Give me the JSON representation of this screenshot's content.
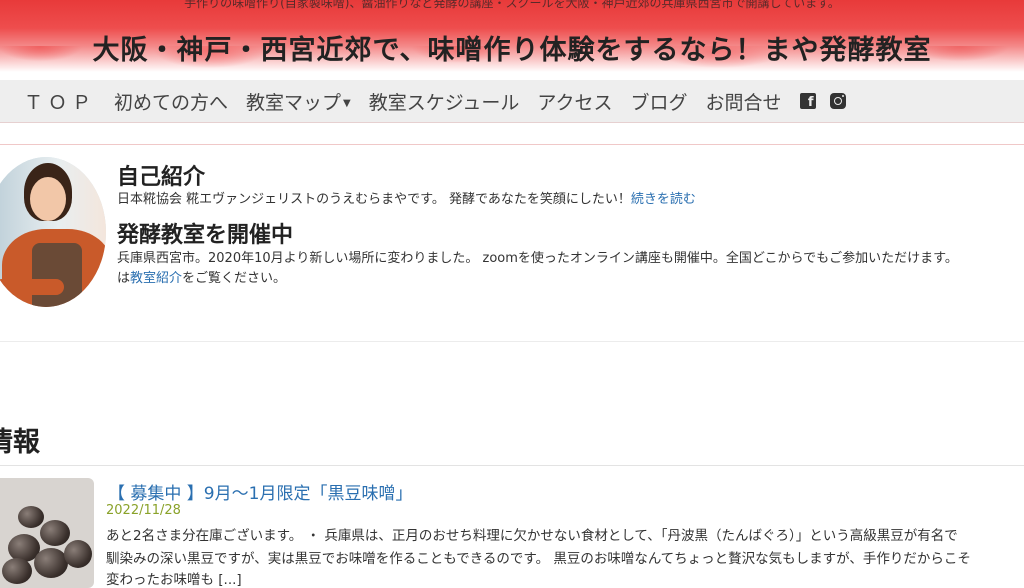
{
  "header": {
    "tagline": "手作りの味噌作り(自家製味噌)、醤油作りなど発酵の講座・スクールを大阪・神戸近郊の兵庫県西宮市で開講しています。",
    "site_title": "大阪・神戸・西宮近郊で、味噌作り体験をするなら！まや発酵教室"
  },
  "nav": {
    "items": [
      "ＴＯＰ",
      "初めての方へ",
      "教室マップ",
      "教室スケジュール",
      "アクセス",
      "ブログ",
      "お問合せ"
    ],
    "icons": [
      "facebook-icon",
      "instagram-icon"
    ]
  },
  "profile": {
    "heading1": "自己紹介",
    "intro_text": "日本糀協会 糀エヴァンジェリストのうえむらまやです。 発酵であなたを笑顔にしたい！",
    "read_more": "続きを読む",
    "heading2": "発酵教室を開催中",
    "class_text_line1": "兵庫県西宮市。2020年10月より新しい場所に変わりました。 zoomを使ったオンライン講座も開催中。全国どこからでもご参加いただけます。",
    "class_text_prefix": "は",
    "class_link": "教室紹介",
    "class_text_suffix": "をご覧ください。"
  },
  "news": {
    "section_title": "情報",
    "item": {
      "title": "【 募集中 】9月～1月限定「黒豆味噌」",
      "date": "2022/11/28",
      "excerpt_line1": "あと2名さま分在庫ございます。 ・ 兵庫県は、正月のおせち料理に欠かせない食材として、「丹波黒（たんばぐろ）」という高級黒豆が有名で",
      "excerpt_line2": "馴染みの深い黒豆ですが、実は黒豆でお味噌を作ることもできるのです。 黒豆のお味噌なんてちょっと贅沢な気もしますが、手作りだからこそ",
      "excerpt_line3": "変わったお味噌も [...]"
    }
  },
  "colors": {
    "header_red": "#e83a3a",
    "link_blue": "#2a6fb0",
    "date_green": "#8aa22a"
  }
}
